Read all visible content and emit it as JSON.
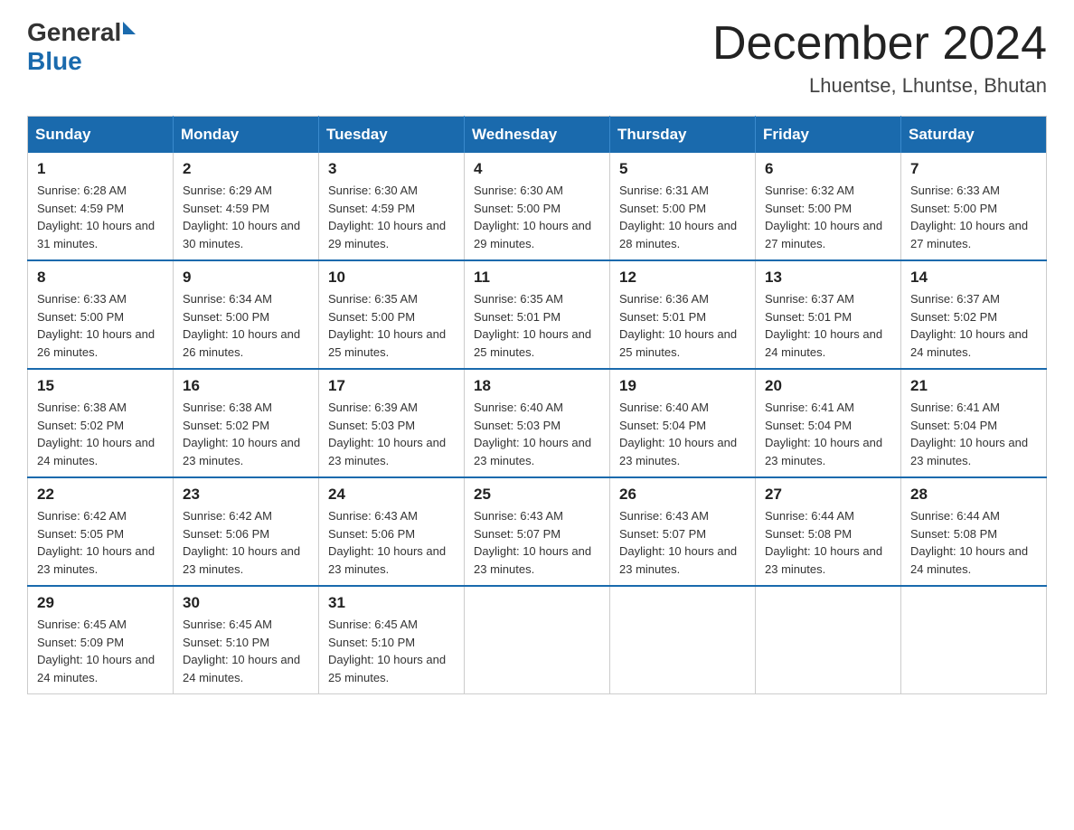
{
  "logo": {
    "text_general": "General",
    "text_blue": "Blue"
  },
  "title": "December 2024",
  "subtitle": "Lhuentse, Lhuntse, Bhutan",
  "days_of_week": [
    "Sunday",
    "Monday",
    "Tuesday",
    "Wednesday",
    "Thursday",
    "Friday",
    "Saturday"
  ],
  "weeks": [
    [
      {
        "day": "1",
        "sunrise": "6:28 AM",
        "sunset": "4:59 PM",
        "daylight": "10 hours and 31 minutes."
      },
      {
        "day": "2",
        "sunrise": "6:29 AM",
        "sunset": "4:59 PM",
        "daylight": "10 hours and 30 minutes."
      },
      {
        "day": "3",
        "sunrise": "6:30 AM",
        "sunset": "4:59 PM",
        "daylight": "10 hours and 29 minutes."
      },
      {
        "day": "4",
        "sunrise": "6:30 AM",
        "sunset": "5:00 PM",
        "daylight": "10 hours and 29 minutes."
      },
      {
        "day": "5",
        "sunrise": "6:31 AM",
        "sunset": "5:00 PM",
        "daylight": "10 hours and 28 minutes."
      },
      {
        "day": "6",
        "sunrise": "6:32 AM",
        "sunset": "5:00 PM",
        "daylight": "10 hours and 27 minutes."
      },
      {
        "day": "7",
        "sunrise": "6:33 AM",
        "sunset": "5:00 PM",
        "daylight": "10 hours and 27 minutes."
      }
    ],
    [
      {
        "day": "8",
        "sunrise": "6:33 AM",
        "sunset": "5:00 PM",
        "daylight": "10 hours and 26 minutes."
      },
      {
        "day": "9",
        "sunrise": "6:34 AM",
        "sunset": "5:00 PM",
        "daylight": "10 hours and 26 minutes."
      },
      {
        "day": "10",
        "sunrise": "6:35 AM",
        "sunset": "5:00 PM",
        "daylight": "10 hours and 25 minutes."
      },
      {
        "day": "11",
        "sunrise": "6:35 AM",
        "sunset": "5:01 PM",
        "daylight": "10 hours and 25 minutes."
      },
      {
        "day": "12",
        "sunrise": "6:36 AM",
        "sunset": "5:01 PM",
        "daylight": "10 hours and 25 minutes."
      },
      {
        "day": "13",
        "sunrise": "6:37 AM",
        "sunset": "5:01 PM",
        "daylight": "10 hours and 24 minutes."
      },
      {
        "day": "14",
        "sunrise": "6:37 AM",
        "sunset": "5:02 PM",
        "daylight": "10 hours and 24 minutes."
      }
    ],
    [
      {
        "day": "15",
        "sunrise": "6:38 AM",
        "sunset": "5:02 PM",
        "daylight": "10 hours and 24 minutes."
      },
      {
        "day": "16",
        "sunrise": "6:38 AM",
        "sunset": "5:02 PM",
        "daylight": "10 hours and 23 minutes."
      },
      {
        "day": "17",
        "sunrise": "6:39 AM",
        "sunset": "5:03 PM",
        "daylight": "10 hours and 23 minutes."
      },
      {
        "day": "18",
        "sunrise": "6:40 AM",
        "sunset": "5:03 PM",
        "daylight": "10 hours and 23 minutes."
      },
      {
        "day": "19",
        "sunrise": "6:40 AM",
        "sunset": "5:04 PM",
        "daylight": "10 hours and 23 minutes."
      },
      {
        "day": "20",
        "sunrise": "6:41 AM",
        "sunset": "5:04 PM",
        "daylight": "10 hours and 23 minutes."
      },
      {
        "day": "21",
        "sunrise": "6:41 AM",
        "sunset": "5:04 PM",
        "daylight": "10 hours and 23 minutes."
      }
    ],
    [
      {
        "day": "22",
        "sunrise": "6:42 AM",
        "sunset": "5:05 PM",
        "daylight": "10 hours and 23 minutes."
      },
      {
        "day": "23",
        "sunrise": "6:42 AM",
        "sunset": "5:06 PM",
        "daylight": "10 hours and 23 minutes."
      },
      {
        "day": "24",
        "sunrise": "6:43 AM",
        "sunset": "5:06 PM",
        "daylight": "10 hours and 23 minutes."
      },
      {
        "day": "25",
        "sunrise": "6:43 AM",
        "sunset": "5:07 PM",
        "daylight": "10 hours and 23 minutes."
      },
      {
        "day": "26",
        "sunrise": "6:43 AM",
        "sunset": "5:07 PM",
        "daylight": "10 hours and 23 minutes."
      },
      {
        "day": "27",
        "sunrise": "6:44 AM",
        "sunset": "5:08 PM",
        "daylight": "10 hours and 23 minutes."
      },
      {
        "day": "28",
        "sunrise": "6:44 AM",
        "sunset": "5:08 PM",
        "daylight": "10 hours and 24 minutes."
      }
    ],
    [
      {
        "day": "29",
        "sunrise": "6:45 AM",
        "sunset": "5:09 PM",
        "daylight": "10 hours and 24 minutes."
      },
      {
        "day": "30",
        "sunrise": "6:45 AM",
        "sunset": "5:10 PM",
        "daylight": "10 hours and 24 minutes."
      },
      {
        "day": "31",
        "sunrise": "6:45 AM",
        "sunset": "5:10 PM",
        "daylight": "10 hours and 25 minutes."
      },
      null,
      null,
      null,
      null
    ]
  ],
  "labels": {
    "sunrise_prefix": "Sunrise: ",
    "sunset_prefix": "Sunset: ",
    "daylight_prefix": "Daylight: "
  }
}
